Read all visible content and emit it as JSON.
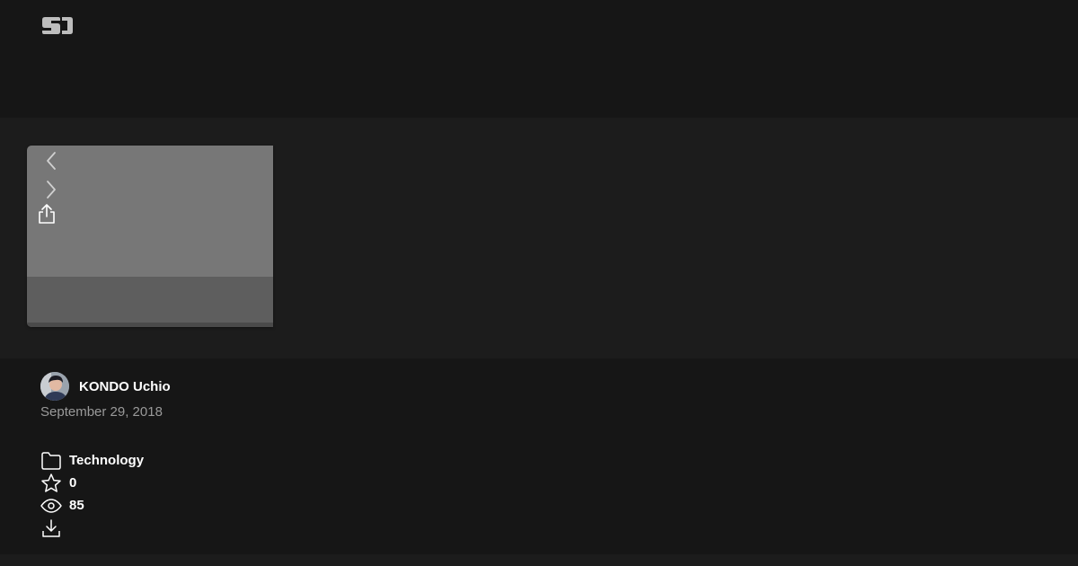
{
  "brand": {
    "logo_icon": "speakerdeck-logo-icon"
  },
  "player": {
    "prev_icon": "chevron-left-icon",
    "next_icon": "chevron-right-icon",
    "share_icon": "share-icon"
  },
  "author": {
    "name": "KONDO Uchio",
    "date": "September 29, 2018"
  },
  "stats": {
    "category": "Technology",
    "stars": "0",
    "views": "85"
  },
  "colors": {
    "background": "#161616",
    "stage": "#1c1c1c",
    "slide": "#777777",
    "slide_bottom": "#5e5e5e",
    "muted_text": "#9a9a9a"
  }
}
